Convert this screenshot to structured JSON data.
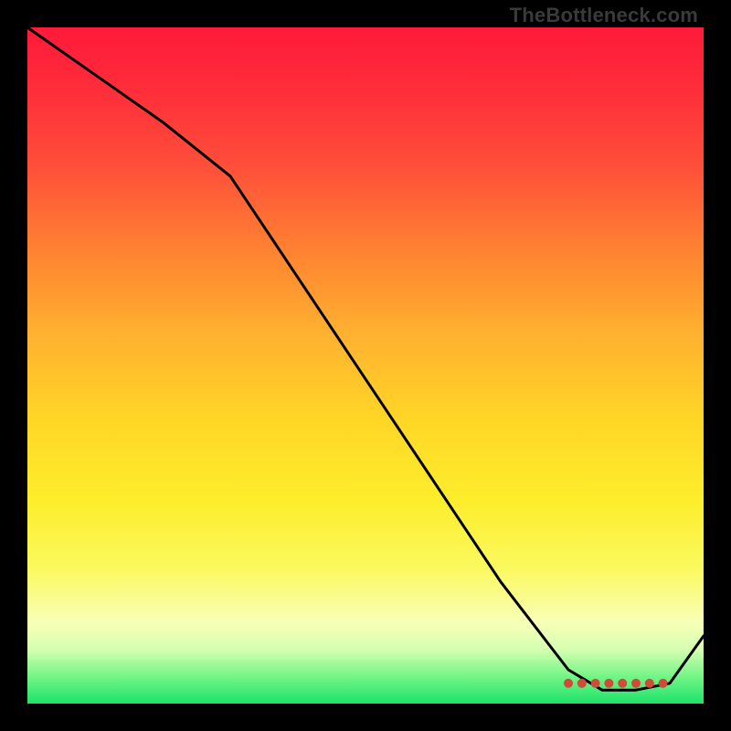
{
  "watermark": "TheBottleneck.com",
  "chart_data": {
    "type": "line",
    "title": "",
    "xlabel": "",
    "ylabel": "",
    "xlim": [
      0,
      100
    ],
    "ylim": [
      0,
      100
    ],
    "grid": false,
    "series": [
      {
        "name": "curve",
        "color": "#000000",
        "x": [
          0,
          10,
          20,
          30,
          40,
          50,
          60,
          70,
          80,
          85,
          90,
          95,
          100
        ],
        "y": [
          100,
          93,
          86,
          78,
          63,
          48,
          33,
          18,
          5,
          2,
          2,
          3,
          10
        ]
      }
    ],
    "markers": {
      "name": "bottom-cluster",
      "color": "#d24a3a",
      "shape": "circle",
      "x": [
        80,
        82,
        84,
        86,
        88,
        90,
        92,
        94
      ],
      "y": [
        3,
        3,
        3,
        3,
        3,
        3,
        3,
        3
      ]
    },
    "background_gradient": {
      "direction": "top-to-bottom",
      "stops": [
        {
          "pos": 0.0,
          "color": "#ff1a3a"
        },
        {
          "pos": 0.35,
          "color": "#ff8a30"
        },
        {
          "pos": 0.7,
          "color": "#fdee2b"
        },
        {
          "pos": 0.9,
          "color": "#f8ffb7"
        },
        {
          "pos": 1.0,
          "color": "#1de36a"
        }
      ]
    }
  }
}
